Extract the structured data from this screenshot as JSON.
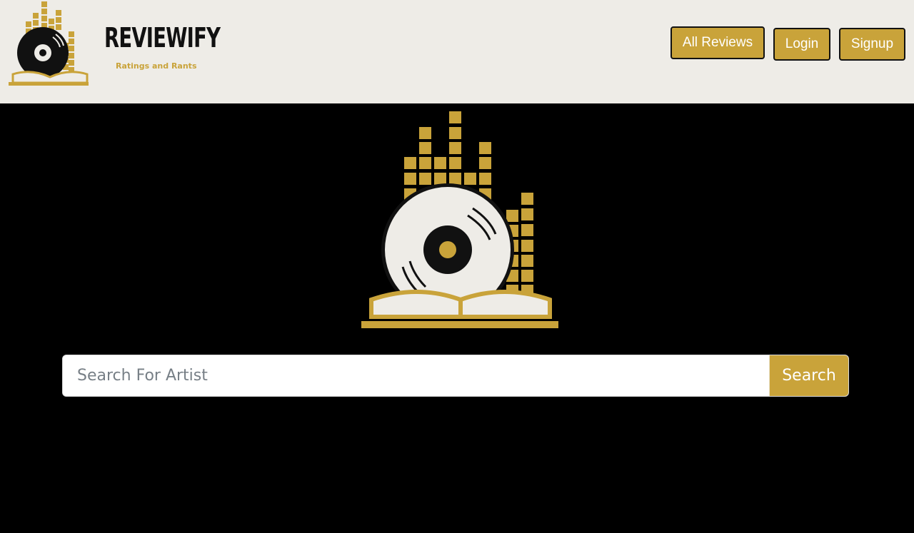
{
  "colors": {
    "accent": "#C9A33A",
    "header_bg": "#EEECE7",
    "page_bg": "#000000",
    "disc": "#EEECE7"
  },
  "header": {
    "brand_name": "REVIEWIFY",
    "brand_tagline": "Ratings and Rants",
    "logo_icon": "vinyl-book-equalizer-icon"
  },
  "nav": {
    "all_reviews": "All Reviews",
    "login": "Login",
    "signup": "Signup"
  },
  "hero": {
    "logo_icon": "vinyl-book-equalizer-icon"
  },
  "search": {
    "placeholder": "Search For Artist",
    "value": "",
    "button_label": "Search"
  }
}
